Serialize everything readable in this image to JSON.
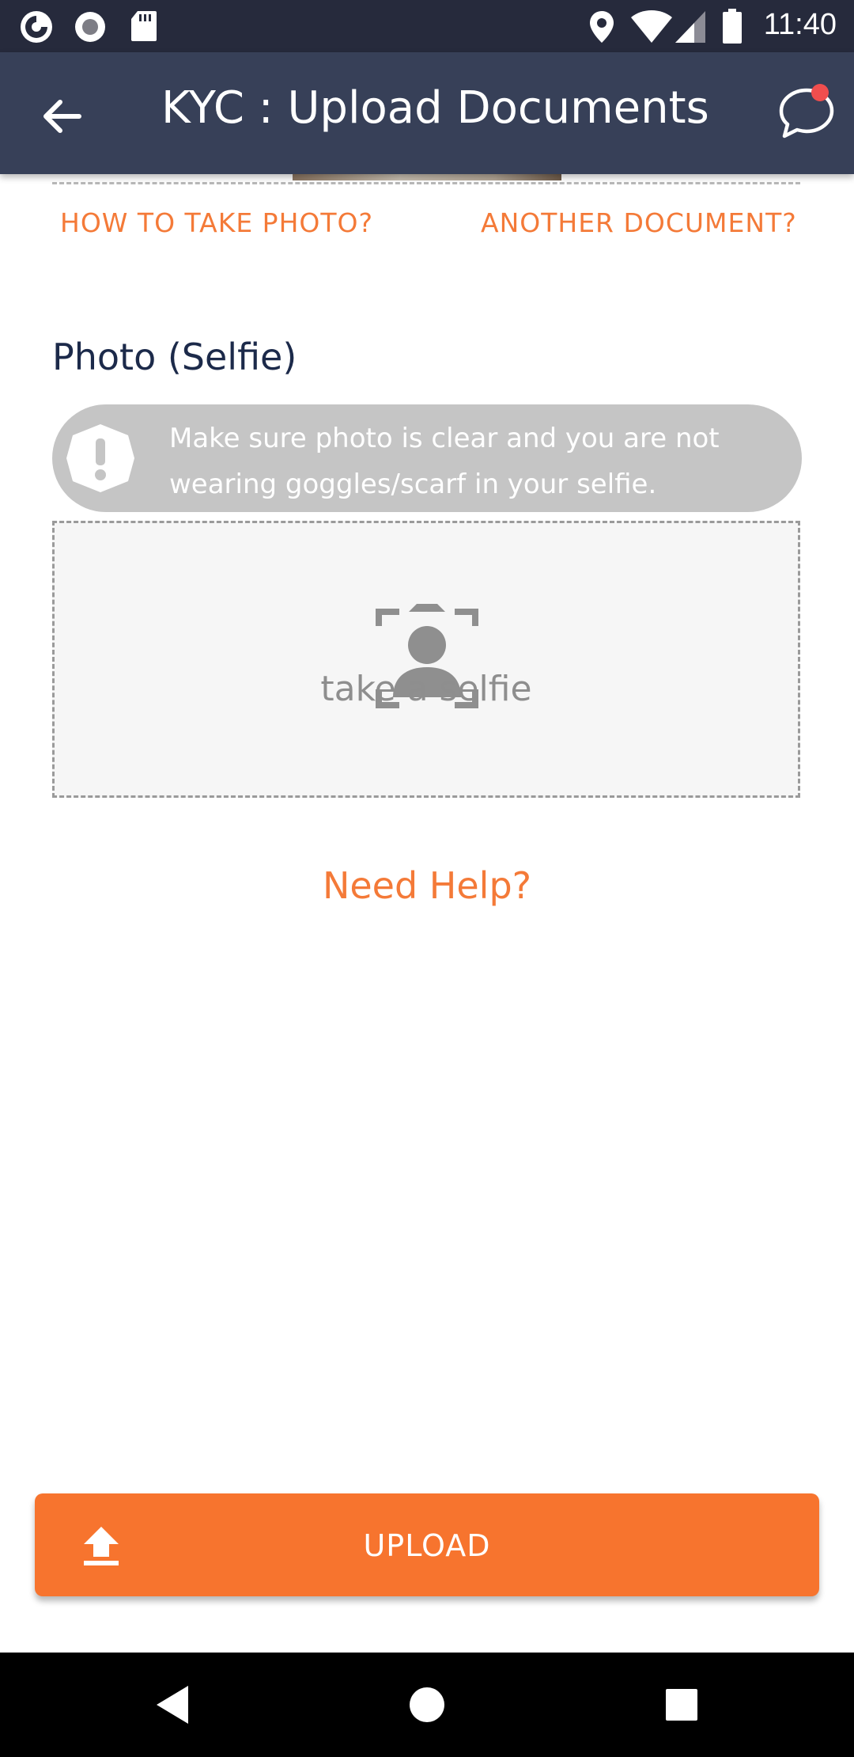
{
  "status_bar": {
    "time": "11:40",
    "left_icons": [
      "app-notification-icon",
      "record-icon",
      "sd-card-icon"
    ],
    "right_icons": [
      "location-icon",
      "wifi-icon",
      "cell-signal-icon",
      "battery-icon"
    ]
  },
  "app_bar": {
    "title": "KYC : Upload Documents",
    "back_icon": "arrow-left-icon",
    "chat_icon": "chat-bubble-icon",
    "has_notification_dot": true
  },
  "links": {
    "how_to_take_photo": "HOW TO TAKE PHOTO?",
    "another_document": "ANOTHER DOCUMENT?"
  },
  "selfie_section": {
    "title": "Photo (Selfie)",
    "alert_text": "Make sure photo is clear and you are not wearing goggles/scarf in your selfie.",
    "alert_icon": "exclamation-icon",
    "capture_label": "take a selfie",
    "capture_icon": "selfie-camera-icon"
  },
  "need_help": "Need Help?",
  "upload_button": {
    "label": "UPLOAD",
    "icon": "upload-icon"
  },
  "colors": {
    "status_bar": "#262a3c",
    "app_bar": "#374058",
    "accent_orange": "#f47a38",
    "upload_button": "#f7742e",
    "alert_banner": "#c5c5c5",
    "title_dark": "#1c2a4a"
  }
}
